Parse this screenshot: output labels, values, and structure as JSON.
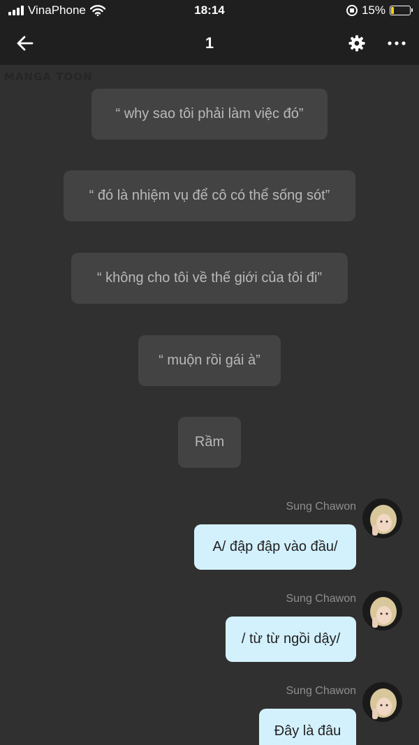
{
  "status_bar": {
    "carrier": "VinaPhone",
    "time": "18:14",
    "battery_percent": "15%",
    "battery_level": 0.15,
    "battery_color": "#ffd60a",
    "icons": [
      "signal-icon",
      "wifi-icon",
      "orientation-lock-icon",
      "battery-icon"
    ]
  },
  "nav": {
    "title": "1",
    "icons": [
      "back-arrow-icon",
      "gear-icon",
      "more-dots-icon"
    ]
  },
  "watermark": "MANGA TOON",
  "narration": [
    "“ why sao tôi phải làm việc đó”",
    "“ đó là nhiệm vụ để cô có thể sống sót”",
    "“ không cho tôi về thế giới của tôi đi”",
    "“ muộn rồi gái à”",
    "Rầm"
  ],
  "messages": [
    {
      "sender": "Sung Chawon",
      "text": "A/ đập đập vào đầu/"
    },
    {
      "sender": "Sung Chawon",
      "text": "/ từ từ ngồi dậy/"
    },
    {
      "sender": "Sung Chawon",
      "text": "Đây là đâu"
    }
  ],
  "colors": {
    "background": "#303030",
    "bar": "#1f1f1f",
    "narration_bubble": "#434343",
    "message_bubble": "#d3f1fd"
  }
}
